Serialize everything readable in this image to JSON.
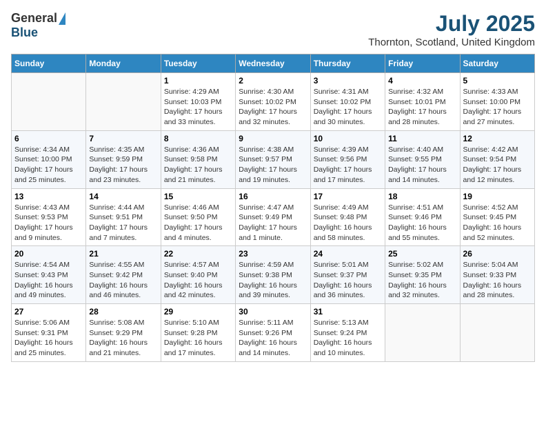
{
  "header": {
    "logo_general": "General",
    "logo_blue": "Blue",
    "month_title": "July 2025",
    "location": "Thornton, Scotland, United Kingdom"
  },
  "weekdays": [
    "Sunday",
    "Monday",
    "Tuesday",
    "Wednesday",
    "Thursday",
    "Friday",
    "Saturday"
  ],
  "weeks": [
    [
      {
        "day": "",
        "info": ""
      },
      {
        "day": "",
        "info": ""
      },
      {
        "day": "1",
        "info": "Sunrise: 4:29 AM\nSunset: 10:03 PM\nDaylight: 17 hours and 33 minutes."
      },
      {
        "day": "2",
        "info": "Sunrise: 4:30 AM\nSunset: 10:02 PM\nDaylight: 17 hours and 32 minutes."
      },
      {
        "day": "3",
        "info": "Sunrise: 4:31 AM\nSunset: 10:02 PM\nDaylight: 17 hours and 30 minutes."
      },
      {
        "day": "4",
        "info": "Sunrise: 4:32 AM\nSunset: 10:01 PM\nDaylight: 17 hours and 28 minutes."
      },
      {
        "day": "5",
        "info": "Sunrise: 4:33 AM\nSunset: 10:00 PM\nDaylight: 17 hours and 27 minutes."
      }
    ],
    [
      {
        "day": "6",
        "info": "Sunrise: 4:34 AM\nSunset: 10:00 PM\nDaylight: 17 hours and 25 minutes."
      },
      {
        "day": "7",
        "info": "Sunrise: 4:35 AM\nSunset: 9:59 PM\nDaylight: 17 hours and 23 minutes."
      },
      {
        "day": "8",
        "info": "Sunrise: 4:36 AM\nSunset: 9:58 PM\nDaylight: 17 hours and 21 minutes."
      },
      {
        "day": "9",
        "info": "Sunrise: 4:38 AM\nSunset: 9:57 PM\nDaylight: 17 hours and 19 minutes."
      },
      {
        "day": "10",
        "info": "Sunrise: 4:39 AM\nSunset: 9:56 PM\nDaylight: 17 hours and 17 minutes."
      },
      {
        "day": "11",
        "info": "Sunrise: 4:40 AM\nSunset: 9:55 PM\nDaylight: 17 hours and 14 minutes."
      },
      {
        "day": "12",
        "info": "Sunrise: 4:42 AM\nSunset: 9:54 PM\nDaylight: 17 hours and 12 minutes."
      }
    ],
    [
      {
        "day": "13",
        "info": "Sunrise: 4:43 AM\nSunset: 9:53 PM\nDaylight: 17 hours and 9 minutes."
      },
      {
        "day": "14",
        "info": "Sunrise: 4:44 AM\nSunset: 9:51 PM\nDaylight: 17 hours and 7 minutes."
      },
      {
        "day": "15",
        "info": "Sunrise: 4:46 AM\nSunset: 9:50 PM\nDaylight: 17 hours and 4 minutes."
      },
      {
        "day": "16",
        "info": "Sunrise: 4:47 AM\nSunset: 9:49 PM\nDaylight: 17 hours and 1 minute."
      },
      {
        "day": "17",
        "info": "Sunrise: 4:49 AM\nSunset: 9:48 PM\nDaylight: 16 hours and 58 minutes."
      },
      {
        "day": "18",
        "info": "Sunrise: 4:51 AM\nSunset: 9:46 PM\nDaylight: 16 hours and 55 minutes."
      },
      {
        "day": "19",
        "info": "Sunrise: 4:52 AM\nSunset: 9:45 PM\nDaylight: 16 hours and 52 minutes."
      }
    ],
    [
      {
        "day": "20",
        "info": "Sunrise: 4:54 AM\nSunset: 9:43 PM\nDaylight: 16 hours and 49 minutes."
      },
      {
        "day": "21",
        "info": "Sunrise: 4:55 AM\nSunset: 9:42 PM\nDaylight: 16 hours and 46 minutes."
      },
      {
        "day": "22",
        "info": "Sunrise: 4:57 AM\nSunset: 9:40 PM\nDaylight: 16 hours and 42 minutes."
      },
      {
        "day": "23",
        "info": "Sunrise: 4:59 AM\nSunset: 9:38 PM\nDaylight: 16 hours and 39 minutes."
      },
      {
        "day": "24",
        "info": "Sunrise: 5:01 AM\nSunset: 9:37 PM\nDaylight: 16 hours and 36 minutes."
      },
      {
        "day": "25",
        "info": "Sunrise: 5:02 AM\nSunset: 9:35 PM\nDaylight: 16 hours and 32 minutes."
      },
      {
        "day": "26",
        "info": "Sunrise: 5:04 AM\nSunset: 9:33 PM\nDaylight: 16 hours and 28 minutes."
      }
    ],
    [
      {
        "day": "27",
        "info": "Sunrise: 5:06 AM\nSunset: 9:31 PM\nDaylight: 16 hours and 25 minutes."
      },
      {
        "day": "28",
        "info": "Sunrise: 5:08 AM\nSunset: 9:29 PM\nDaylight: 16 hours and 21 minutes."
      },
      {
        "day": "29",
        "info": "Sunrise: 5:10 AM\nSunset: 9:28 PM\nDaylight: 16 hours and 17 minutes."
      },
      {
        "day": "30",
        "info": "Sunrise: 5:11 AM\nSunset: 9:26 PM\nDaylight: 16 hours and 14 minutes."
      },
      {
        "day": "31",
        "info": "Sunrise: 5:13 AM\nSunset: 9:24 PM\nDaylight: 16 hours and 10 minutes."
      },
      {
        "day": "",
        "info": ""
      },
      {
        "day": "",
        "info": ""
      }
    ]
  ]
}
